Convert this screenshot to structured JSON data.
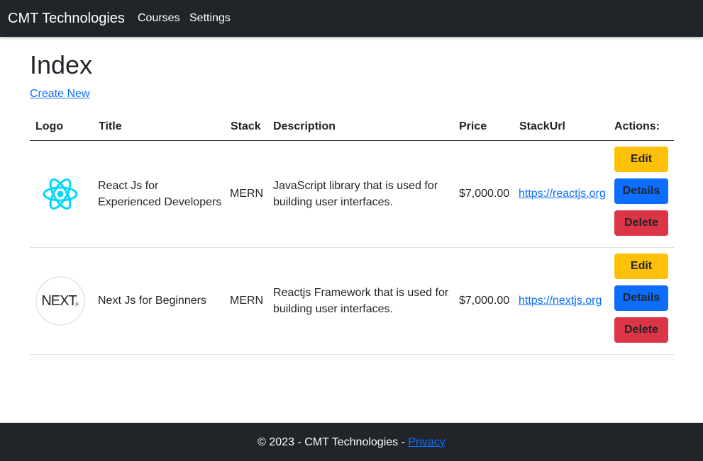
{
  "navbar": {
    "brand": "CMT Technologies",
    "links": [
      "Courses",
      "Settings"
    ]
  },
  "page": {
    "title": "Index",
    "create_link": "Create New"
  },
  "table": {
    "headers": [
      "Logo",
      "Title",
      "Stack",
      "Description",
      "Price",
      "StackUrl",
      "Actions:"
    ],
    "rows": [
      {
        "logo_icon": "react-logo-icon",
        "title_line1": "React Js for",
        "title_line2": "Experienced Developers",
        "stack": "MERN",
        "desc_line1": "JavaScript library that is used for",
        "desc_line2": "building user interfaces.",
        "price": "$7,000.00",
        "url": "https://reactjs.org"
      },
      {
        "logo_icon": "nextjs-logo-icon",
        "logo_text": "NEXT",
        "logo_suffix": ".js",
        "title_line1": "Next Js for Beginners",
        "stack": "MERN",
        "desc_line1": "Reactjs Framework that is used for",
        "desc_line2": "building user interfaces.",
        "price": "$7,000.00",
        "url": "https://nextjs.org"
      }
    ],
    "actions": {
      "edit": "Edit",
      "details": "Details",
      "delete": "Delete"
    }
  },
  "footer": {
    "text": "© 2023 - CMT Technologies - ",
    "privacy": "Privacy"
  },
  "colors": {
    "navbar_bg": "#212529",
    "link": "#0d6efd",
    "edit": "#ffc107",
    "details": "#0d6efd",
    "delete": "#dc3545",
    "react": "#00d8ff"
  }
}
